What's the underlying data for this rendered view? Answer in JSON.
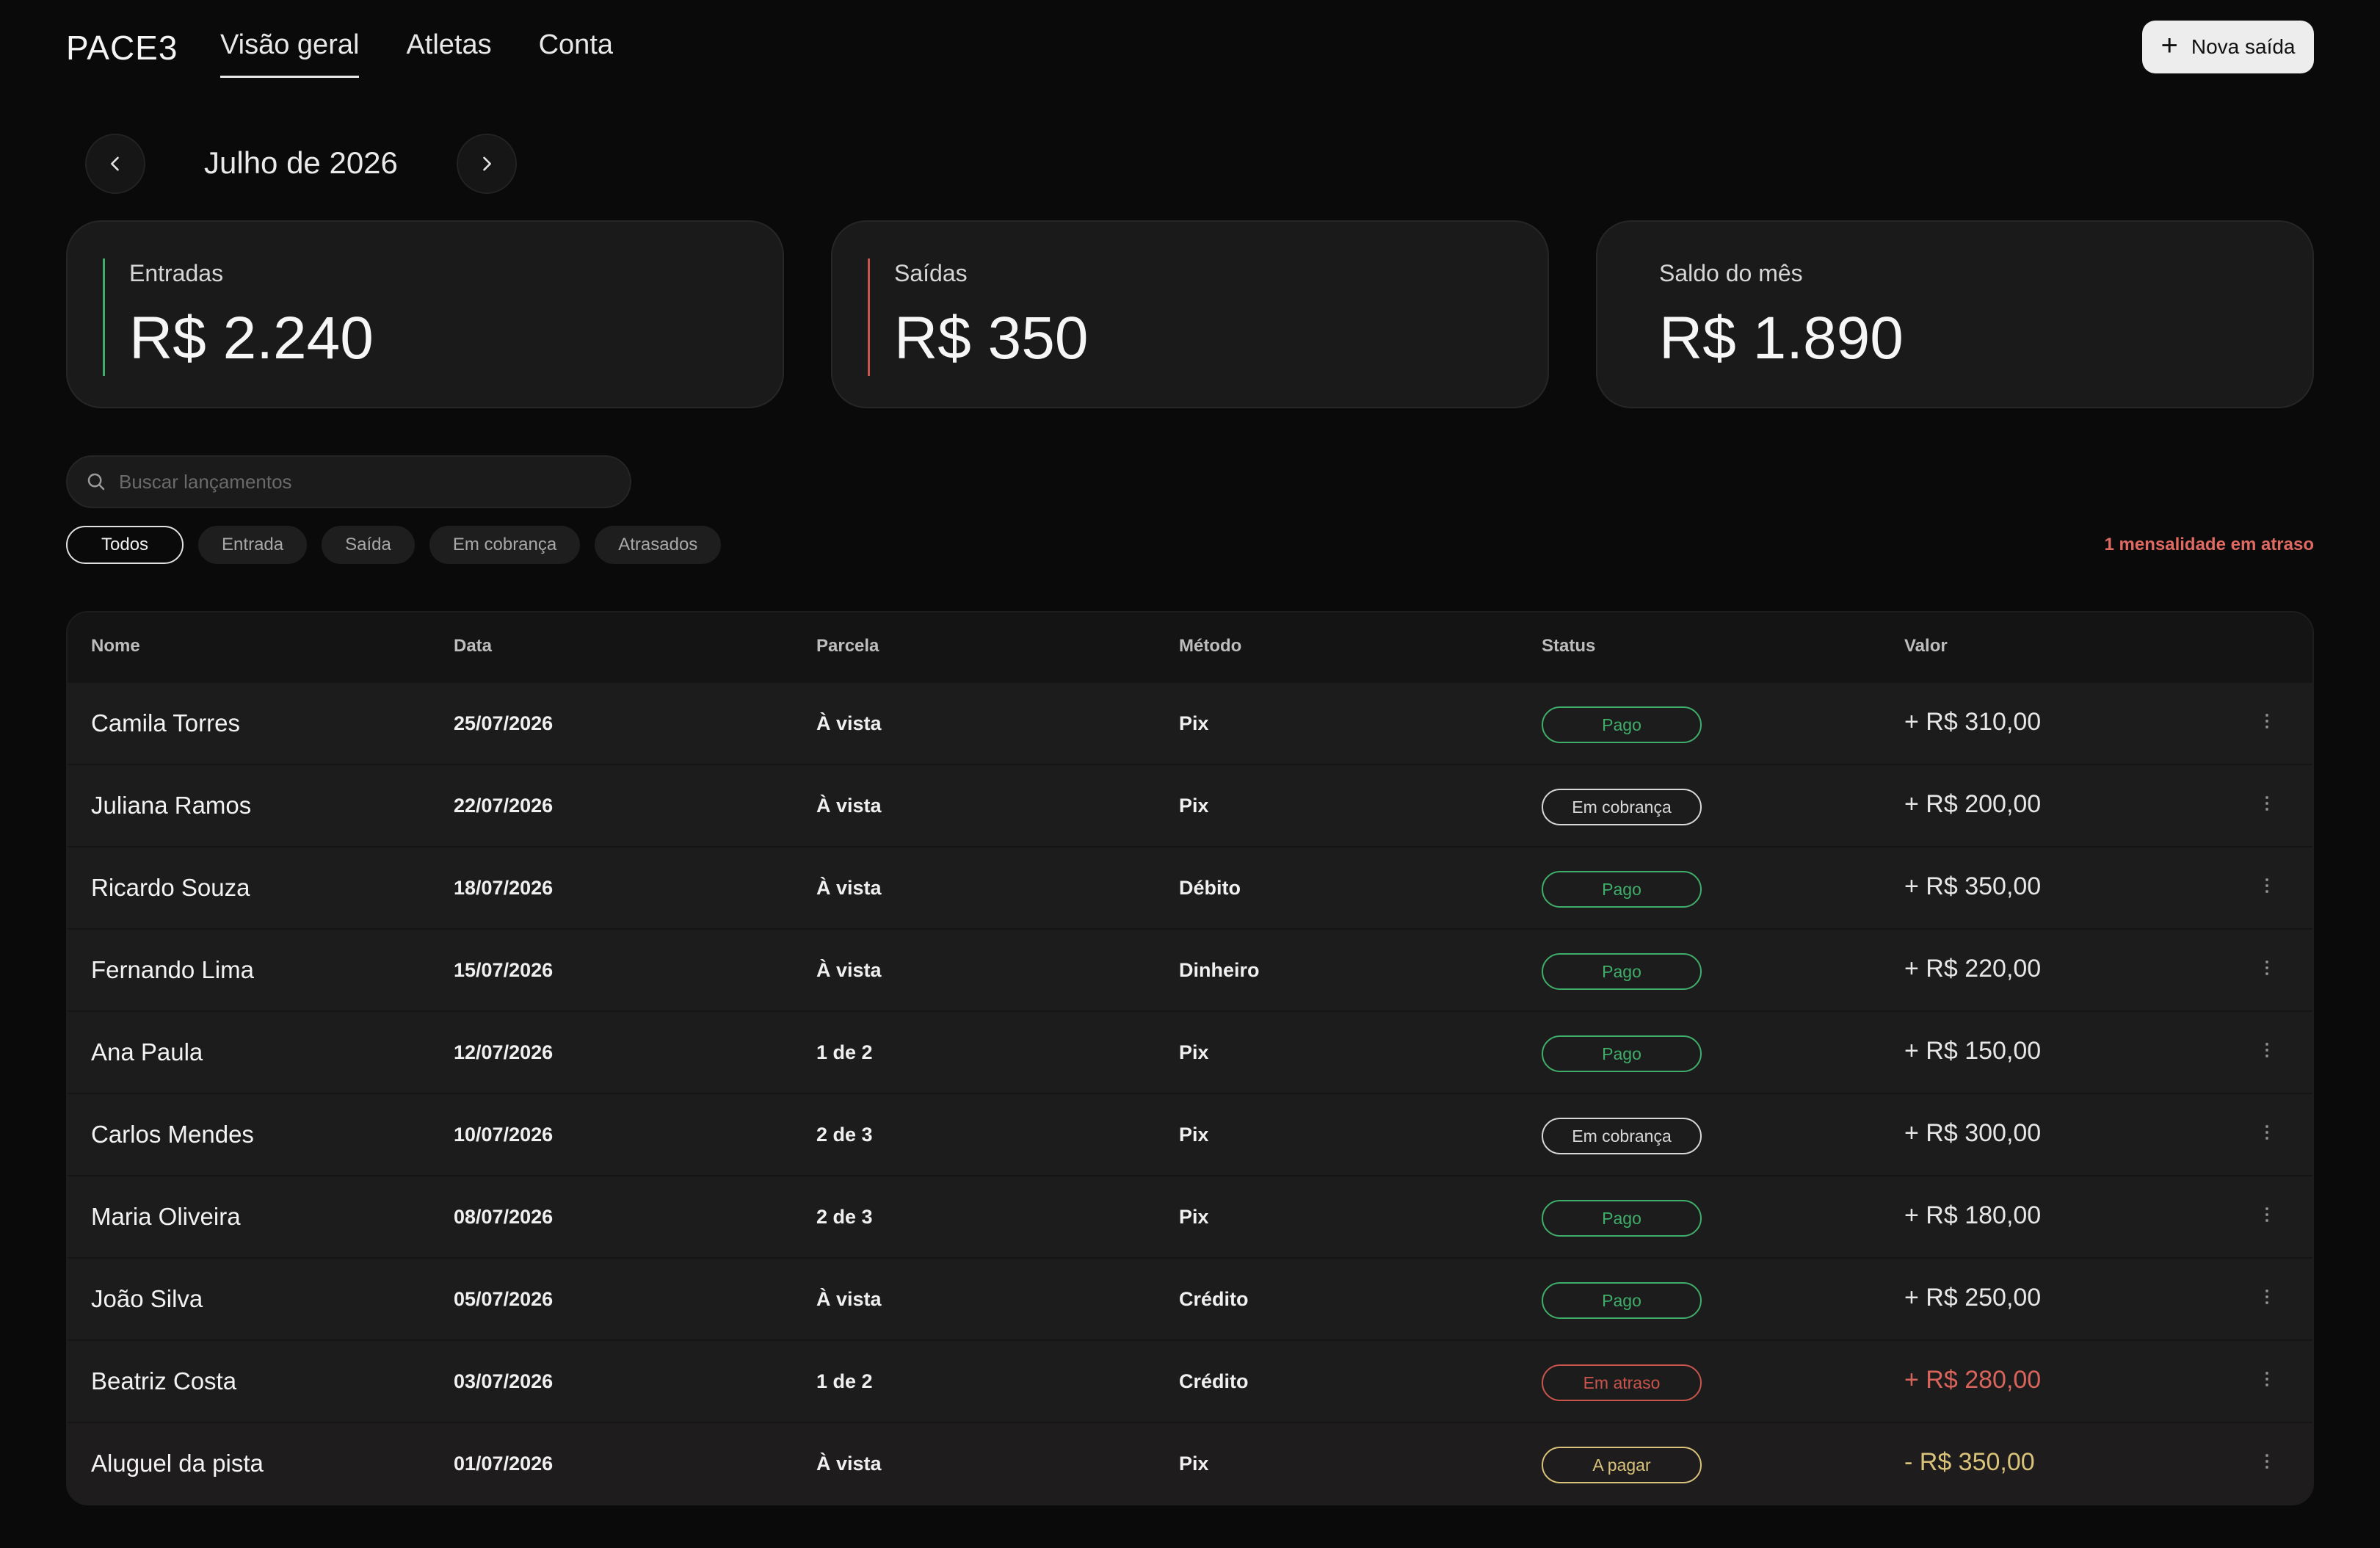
{
  "app": {
    "logo": "PACE3",
    "nav": [
      {
        "label": "Visão geral",
        "active": true
      },
      {
        "label": "Atletas",
        "active": false
      },
      {
        "label": "Conta",
        "active": false
      }
    ],
    "new_button": {
      "icon": "plus-icon",
      "label": "Nova saída"
    }
  },
  "month": {
    "label": "Julho de 2026",
    "prev_icon": "chevron-left-icon",
    "next_icon": "chevron-right-icon"
  },
  "summary": [
    {
      "label": "Entradas",
      "value": "R$ 2.240",
      "accent": "#3fae6a"
    },
    {
      "label": "Saídas",
      "value": "R$ 350",
      "accent": "#c9544c"
    },
    {
      "label": "Saldo do mês",
      "value": "R$ 1.890",
      "accent": ""
    }
  ],
  "search": {
    "placeholder": "Buscar lançamentos",
    "value": "",
    "icon": "search-icon"
  },
  "filters": [
    {
      "label": "Todos",
      "active": true
    },
    {
      "label": "Entrada",
      "active": false
    },
    {
      "label": "Saída",
      "active": false
    },
    {
      "label": "Em cobrança",
      "active": false
    },
    {
      "label": "Atrasados",
      "active": false
    }
  ],
  "alert": "1 mensalidade em atraso",
  "table": {
    "columns": [
      "Nome",
      "Data",
      "Parcela",
      "Método",
      "Status",
      "Valor"
    ],
    "status_colors": {
      "Pago": "#3fae6a",
      "Em cobrança": "#d8d8d8",
      "Em atraso": "#c9544c",
      "A pagar": "#d9c27a"
    },
    "rows": [
      {
        "nome": "Camila Torres",
        "data": "25/07/2026",
        "parcela": "À vista",
        "metodo": "Pix",
        "status": "Pago",
        "valor": "+ R$ 310,00",
        "valor_color": "#e6e6e6"
      },
      {
        "nome": "Juliana Ramos",
        "data": "22/07/2026",
        "parcela": "À vista",
        "metodo": "Pix",
        "status": "Em cobrança",
        "valor": "+ R$ 200,00",
        "valor_color": "#e6e6e6"
      },
      {
        "nome": "Ricardo Souza",
        "data": "18/07/2026",
        "parcela": "À vista",
        "metodo": "Débito",
        "status": "Pago",
        "valor": "+ R$ 350,00",
        "valor_color": "#e6e6e6"
      },
      {
        "nome": "Fernando Lima",
        "data": "15/07/2026",
        "parcela": "À vista",
        "metodo": "Dinheiro",
        "status": "Pago",
        "valor": "+ R$ 220,00",
        "valor_color": "#e6e6e6"
      },
      {
        "nome": "Ana Paula",
        "data": "12/07/2026",
        "parcela": "1 de 2",
        "metodo": "Pix",
        "status": "Pago",
        "valor": "+ R$ 150,00",
        "valor_color": "#e6e6e6"
      },
      {
        "nome": "Carlos Mendes",
        "data": "10/07/2026",
        "parcela": "2 de 3",
        "metodo": "Pix",
        "status": "Em cobrança",
        "valor": "+ R$ 300,00",
        "valor_color": "#e6e6e6"
      },
      {
        "nome": "Maria Oliveira",
        "data": "08/07/2026",
        "parcela": "2 de 3",
        "metodo": "Pix",
        "status": "Pago",
        "valor": "+ R$ 180,00",
        "valor_color": "#e6e6e6"
      },
      {
        "nome": "João Silva",
        "data": "05/07/2026",
        "parcela": "À vista",
        "metodo": "Crédito",
        "status": "Pago",
        "valor": "+ R$ 250,00",
        "valor_color": "#e6e6e6"
      },
      {
        "nome": "Beatriz Costa",
        "data": "03/07/2026",
        "parcela": "1 de 2",
        "metodo": "Crédito",
        "status": "Em atraso",
        "valor": "+ R$ 280,00",
        "valor_color": "#d9645c"
      },
      {
        "nome": "Aluguel da pista",
        "data": "01/07/2026",
        "parcela": "À vista",
        "metodo": "Pix",
        "status": "A pagar",
        "valor": "- R$ 350,00",
        "valor_color": "#d9c27a"
      }
    ],
    "row_menu_icon": "more-vertical-icon"
  }
}
